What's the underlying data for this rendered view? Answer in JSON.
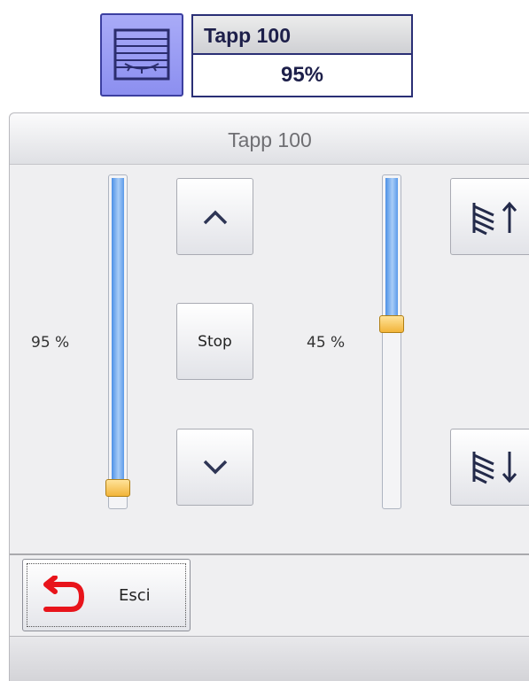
{
  "tile": {
    "icon": "blind-window-icon",
    "title": "Tapp 100",
    "value": "95%"
  },
  "window": {
    "title": "Tapp 100"
  },
  "position_slider": {
    "label": "95 %",
    "level": 0.95
  },
  "tilt_slider": {
    "label": "45 %",
    "level": 0.45
  },
  "buttons": {
    "up_icon": "chevron-up-icon",
    "stop_label": "Stop",
    "down_icon": "chevron-down-icon",
    "tilt_up_icon": "slats-tilt-up-icon",
    "tilt_down_icon": "slats-tilt-down-icon"
  },
  "exit": {
    "label": "Esci",
    "icon": "return-arrow-icon"
  },
  "colors": {
    "tile_accent": "#8c8ff0",
    "slider_fill": "#4d90e6",
    "slider_thumb": "#f2b43a",
    "exit_icon": "#e8141b"
  }
}
